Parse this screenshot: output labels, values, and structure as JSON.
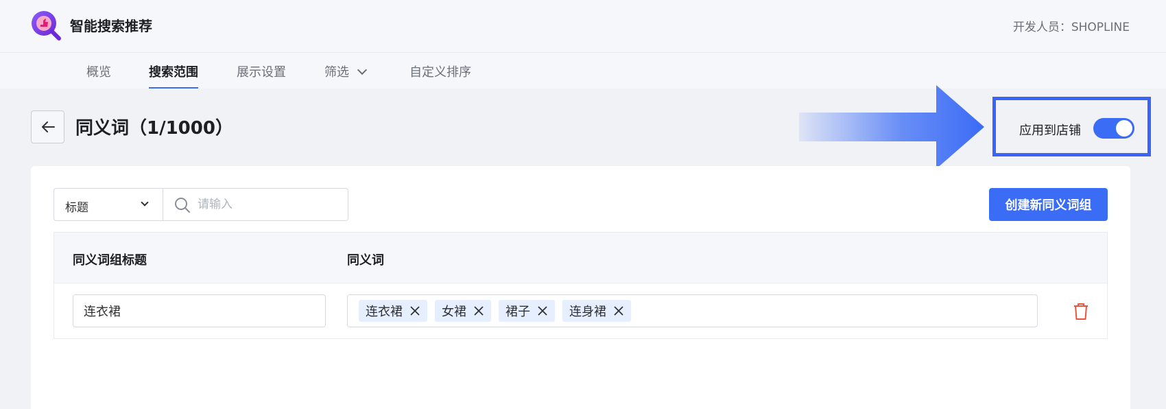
{
  "header": {
    "app_title": "智能搜索推荐",
    "developer_label": "开发人员：SHOPLINE"
  },
  "nav": {
    "tabs": [
      {
        "label": "概览"
      },
      {
        "label": "搜索范围",
        "active": true
      },
      {
        "label": "展示设置"
      },
      {
        "label": "筛选",
        "has_dropdown": true
      },
      {
        "label": "自定义排序"
      }
    ]
  },
  "page": {
    "title": "同义词（1/1000）",
    "apply_to_store_label": "应用到店铺",
    "apply_to_store_enabled": true
  },
  "toolbar": {
    "filter_select_value": "标题",
    "search_placeholder": "请输入",
    "create_button_label": "创建新同义词组"
  },
  "table": {
    "columns": [
      "同义词组标题",
      "同义词"
    ],
    "rows": [
      {
        "group_title": "连衣裙",
        "synonyms": [
          "连衣裙",
          "女裙",
          "裙子",
          "连身裙"
        ]
      }
    ]
  },
  "colors": {
    "accent": "#3b6cf6",
    "highlight_border": "#3b63f5",
    "danger": "#e8553e",
    "tag_bg": "#e6efff"
  }
}
